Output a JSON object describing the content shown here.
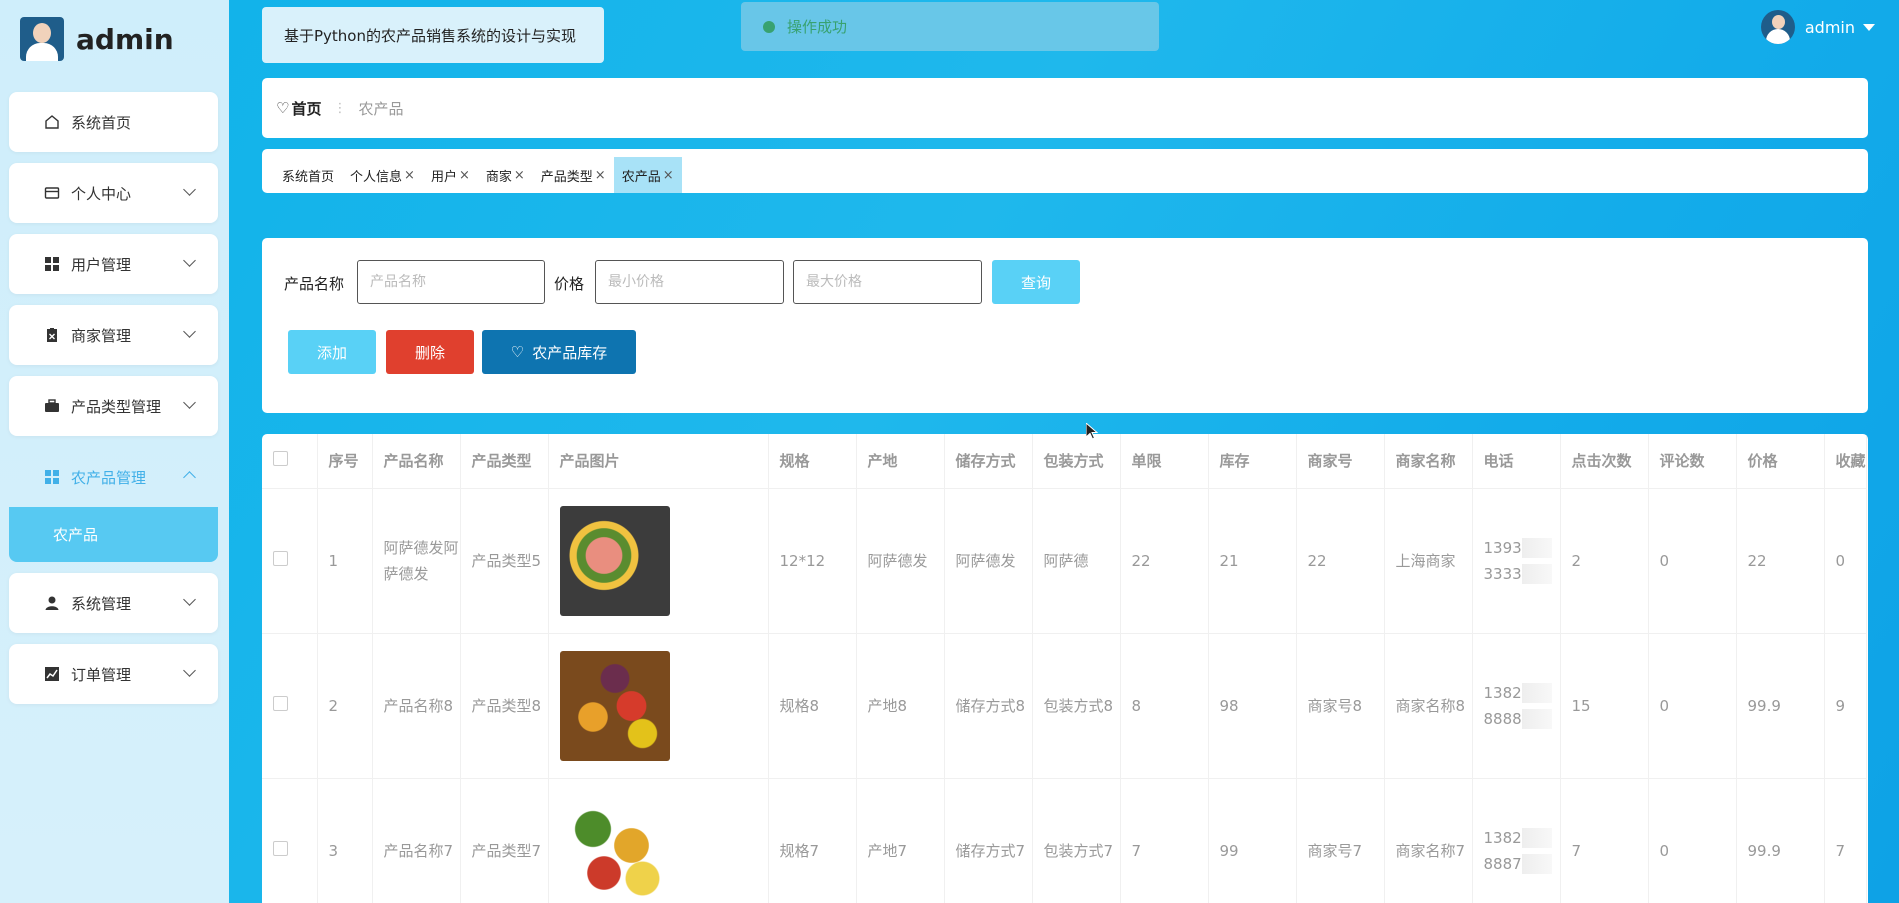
{
  "sidebar": {
    "brand_name": "admin",
    "items": [
      {
        "label": "系统首页",
        "icon": "home-icon"
      },
      {
        "label": "个人中心",
        "icon": "wallet-icon"
      },
      {
        "label": "用户管理",
        "icon": "grid-icon"
      },
      {
        "label": "商家管理",
        "icon": "clipboard-icon"
      },
      {
        "label": "产品类型管理",
        "icon": "briefcase-icon"
      },
      {
        "label": "农产品管理",
        "icon": "grid-icon",
        "expanded": true
      },
      {
        "label": "系统管理",
        "icon": "user-icon"
      },
      {
        "label": "订单管理",
        "icon": "chart-icon"
      }
    ],
    "submenu": {
      "label": "农产品"
    }
  },
  "header": {
    "system_title": "基于Python的农产品销售系统的设计与实现",
    "toast": "操作成功",
    "user_name": "admin"
  },
  "breadcrumb": {
    "home": "首页",
    "current": "农产品"
  },
  "tags": [
    {
      "label": "系统首页",
      "closable": false
    },
    {
      "label": "个人信息",
      "closable": true
    },
    {
      "label": "用户",
      "closable": true
    },
    {
      "label": "商家",
      "closable": true
    },
    {
      "label": "产品类型",
      "closable": true
    },
    {
      "label": "农产品",
      "closable": true,
      "active": true
    }
  ],
  "search": {
    "name_label": "产品名称",
    "name_placeholder": "产品名称",
    "price_label": "价格",
    "min_placeholder": "最小价格",
    "max_placeholder": "最大价格",
    "query_label": "查询",
    "add_label": "添加",
    "delete_label": "删除",
    "stock_label": "农产品库存"
  },
  "table": {
    "columns": [
      "序号",
      "产品名称",
      "产品类型",
      "产品图片",
      "规格",
      "产地",
      "储存方式",
      "包装方式",
      "单限",
      "库存",
      "商家号",
      "商家名称",
      "电话",
      "点击次数",
      "评论数",
      "价格",
      "收藏"
    ],
    "rows": [
      {
        "no": "1",
        "name": "阿萨德发阿萨德发",
        "type": "产品类型5",
        "spec": "12*12",
        "origin": "阿萨德发",
        "storage": "阿萨德发",
        "pack": "阿萨德",
        "limit": "22",
        "stock": "21",
        "shop_no": "22",
        "shop_name": "上海商家",
        "phone1": "1393",
        "phone2": "3333",
        "clicks": "2",
        "comments": "0",
        "price": "22",
        "fav": "0"
      },
      {
        "no": "2",
        "name": "产品名称8",
        "type": "产品类型8",
        "spec": "规格8",
        "origin": "产地8",
        "storage": "储存方式8",
        "pack": "包装方式8",
        "limit": "8",
        "stock": "98",
        "shop_no": "商家号8",
        "shop_name": "商家名称8",
        "phone1": "1382",
        "phone2": "8888",
        "clicks": "15",
        "comments": "0",
        "price": "99.9",
        "fav": "9"
      },
      {
        "no": "3",
        "name": "产品名称7",
        "type": "产品类型7",
        "spec": "规格7",
        "origin": "产地7",
        "storage": "储存方式7",
        "pack": "包装方式7",
        "limit": "7",
        "stock": "99",
        "shop_no": "商家号7",
        "shop_name": "商家名称7",
        "phone1": "1382",
        "phone2": "8887",
        "clicks": "7",
        "comments": "0",
        "price": "99.9",
        "fav": "7"
      }
    ]
  }
}
